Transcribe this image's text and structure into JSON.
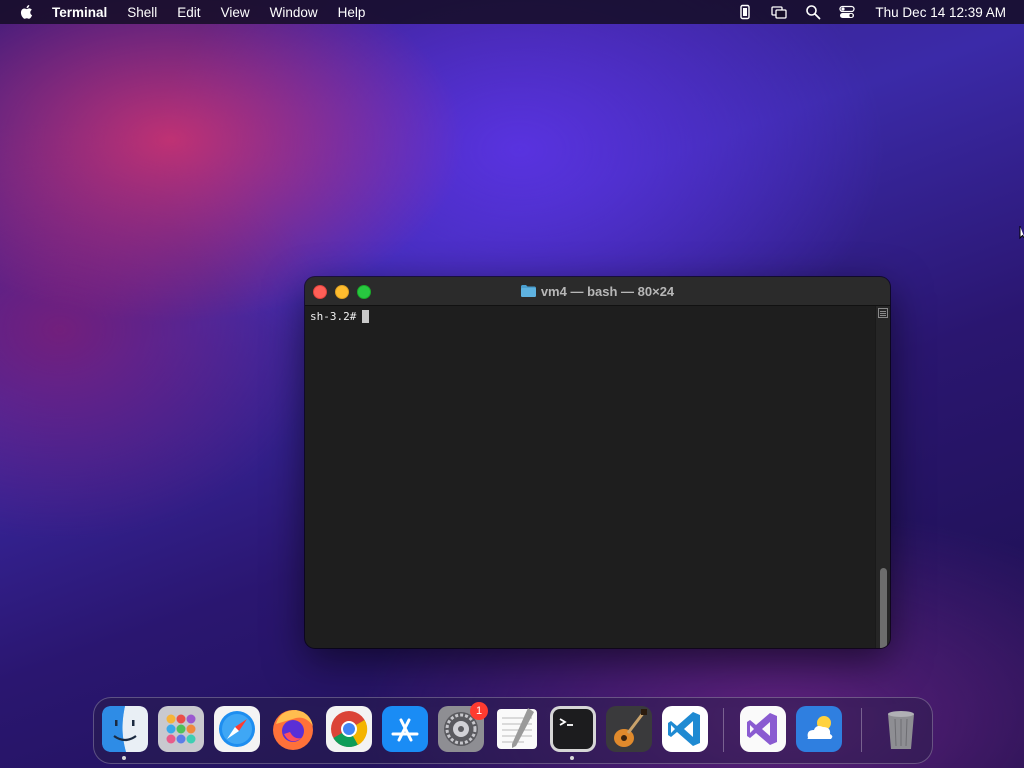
{
  "menubar": {
    "app_name": "Terminal",
    "menus": [
      "Shell",
      "Edit",
      "View",
      "Window",
      "Help"
    ],
    "clock": "Thu Dec 14  12:39 AM",
    "status_icons": [
      "battery-icon",
      "screen-mirroring-icon",
      "spotlight-search-icon",
      "control-center-icon"
    ]
  },
  "terminal": {
    "title": "vm4 — bash — 80×24",
    "prompt": "sh-3.2#"
  },
  "dock": {
    "items": [
      {
        "name": "Finder",
        "icon": "finder-icon",
        "running": true
      },
      {
        "name": "Launchpad",
        "icon": "launchpad-icon",
        "running": false
      },
      {
        "name": "Safari",
        "icon": "safari-icon",
        "running": false
      },
      {
        "name": "Firefox",
        "icon": "firefox-icon",
        "running": false
      },
      {
        "name": "Google Chrome",
        "icon": "chrome-icon",
        "running": false
      },
      {
        "name": "App Store",
        "icon": "app-store-icon",
        "running": false
      },
      {
        "name": "System Preferences",
        "icon": "system-preferences-icon",
        "running": false,
        "badge": "1"
      },
      {
        "name": "TextEdit",
        "icon": "textedit-icon",
        "running": false
      },
      {
        "name": "Terminal",
        "icon": "terminal-icon",
        "running": true
      },
      {
        "name": "GarageBand",
        "icon": "garageband-icon",
        "running": false
      },
      {
        "name": "Visual Studio Code",
        "icon": "vscode-icon",
        "running": false
      },
      {
        "name": "Visual Studio",
        "icon": "visual-studio-icon",
        "running": false
      },
      {
        "name": "Weather",
        "icon": "weather-icon",
        "running": false
      },
      {
        "name": "Trash",
        "icon": "trash-icon",
        "running": false
      }
    ]
  },
  "colors": {
    "close": "#ff5f57",
    "minimize": "#febc2e",
    "zoom": "#28c840",
    "badge": "#ff3b30"
  }
}
